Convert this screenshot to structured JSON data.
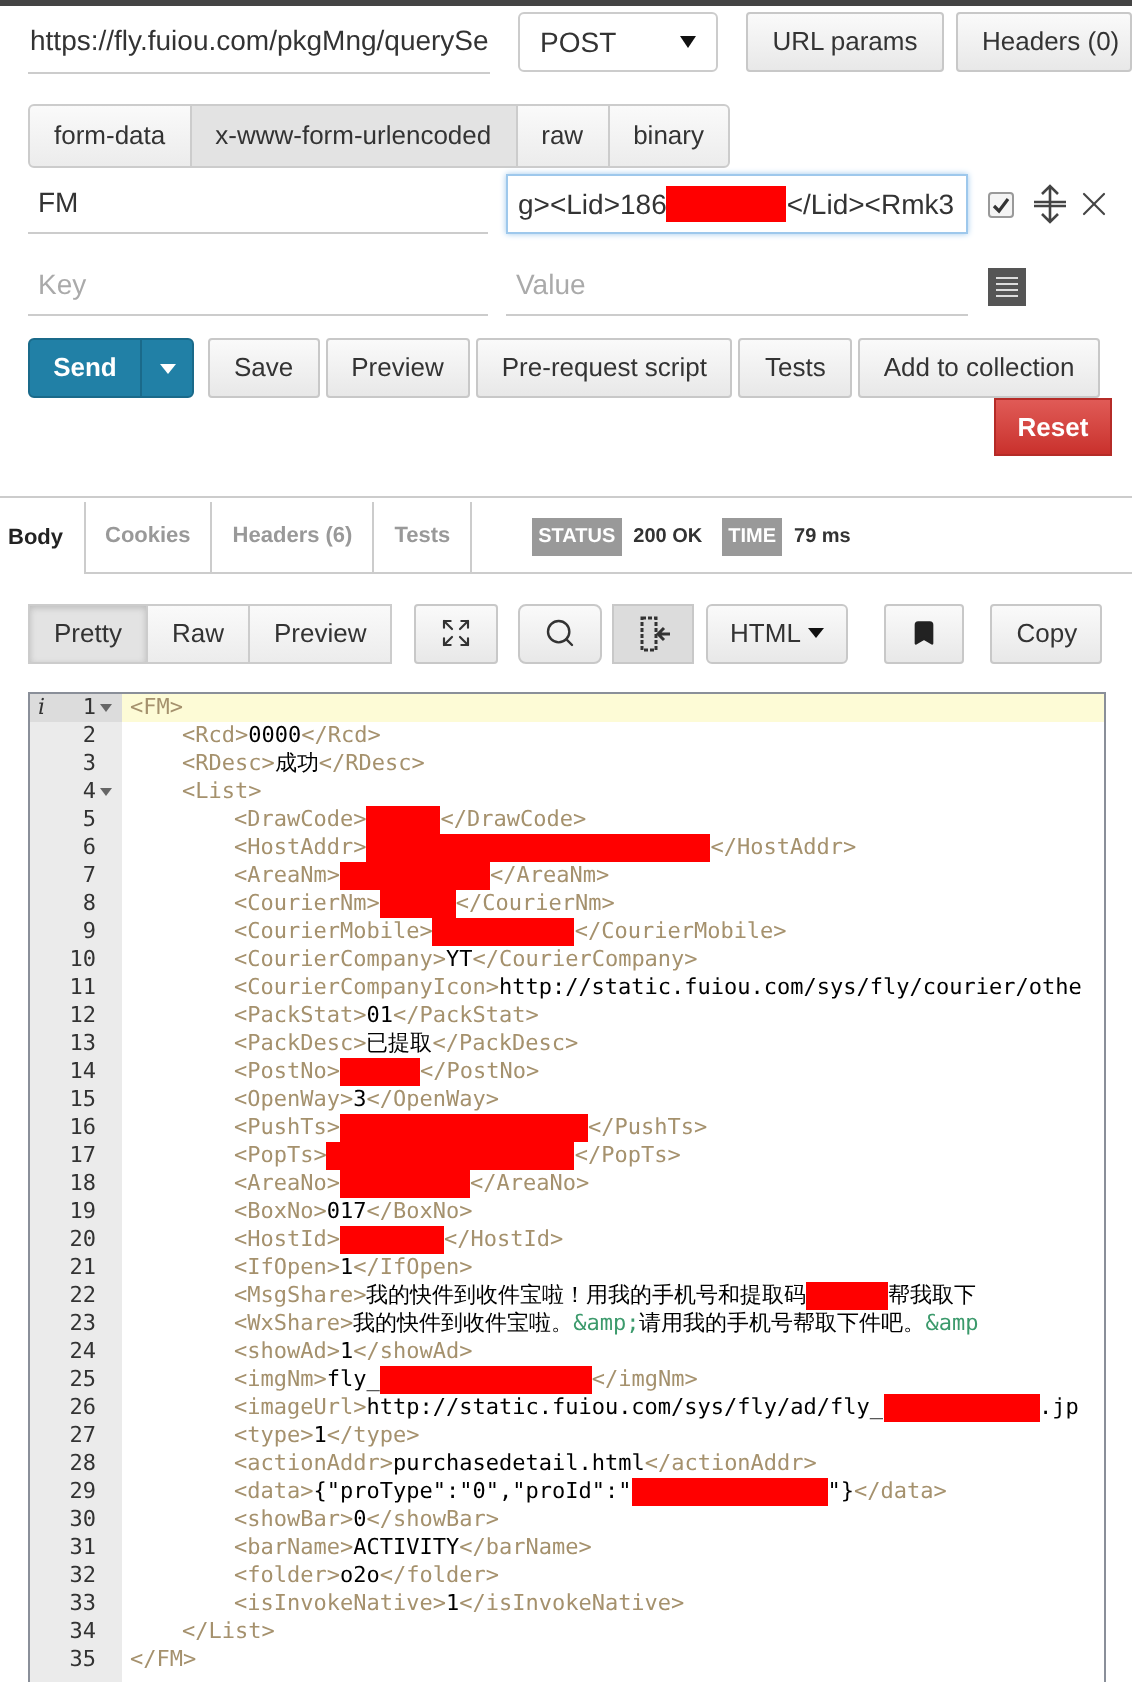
{
  "request": {
    "url": "https://fly.fuiou.com/pkgMng/querySe",
    "method": "POST",
    "buttons": [
      "URL params",
      "Headers (0)"
    ]
  },
  "body_tabs": [
    {
      "label": "form-data",
      "selected": false
    },
    {
      "label": "x-www-form-urlencoded",
      "selected": true
    },
    {
      "label": "raw",
      "selected": false
    },
    {
      "label": "binary",
      "selected": false
    }
  ],
  "params": [
    {
      "key": "FM",
      "value_parts": [
        {
          "kind": "text",
          "text": "g><Lid>186"
        },
        {
          "kind": "redacted"
        },
        {
          "kind": "text",
          "text": "</Lid><Rmk3"
        }
      ],
      "checked": true,
      "focused": true
    }
  ],
  "new_param": {
    "key_placeholder": "Key",
    "value_placeholder": "Value"
  },
  "actions": {
    "send": "Send",
    "buttons": [
      "Save",
      "Preview",
      "Pre-request script",
      "Tests",
      "Add to collection"
    ],
    "reset": "Reset"
  },
  "response_tabs": [
    {
      "label": "Body",
      "selected": true
    },
    {
      "label": "Cookies",
      "selected": false
    },
    {
      "label": "Headers (6)",
      "selected": false
    },
    {
      "label": "Tests",
      "selected": false
    }
  ],
  "status": {
    "label": "STATUS",
    "value": "200 OK"
  },
  "time": {
    "label": "TIME",
    "value": "79 ms"
  },
  "view_modes": [
    {
      "label": "Pretty",
      "selected": true
    },
    {
      "label": "Raw",
      "selected": false
    },
    {
      "label": "Preview",
      "selected": false
    }
  ],
  "wrap_on": true,
  "format": "HTML",
  "copy": "Copy",
  "editor": {
    "lines": [
      {
        "number": "1",
        "selected": true,
        "annotation": "i",
        "expanded": true,
        "parts": [
          {
            "kind": "tag",
            "text": "<FM>"
          }
        ],
        "children": [
          {
            "number": "2",
            "selected": false,
            "parts": [
              {
                "kind": "tag",
                "text": "<Rcd>"
              },
              {
                "kind": "text",
                "text": "0000"
              },
              {
                "kind": "tag",
                "text": "</Rcd>"
              }
            ]
          },
          {
            "number": "3",
            "selected": false,
            "parts": [
              {
                "kind": "tag",
                "text": "<RDesc>"
              },
              {
                "kind": "text",
                "text": "成功"
              },
              {
                "kind": "tag",
                "text": "</RDesc>"
              }
            ]
          },
          {
            "number": "4",
            "selected": false,
            "expanded": true,
            "parts": [
              {
                "kind": "tag",
                "text": "<List>"
              }
            ],
            "children": [
              {
                "number": "5",
                "selected": false,
                "parts": [
                  {
                    "kind": "tag",
                    "text": "<DrawCode>"
                  },
                  {
                    "kind": "redacted"
                  },
                  {
                    "kind": "tag",
                    "text": "</DrawCode>"
                  }
                ]
              },
              {
                "number": "6",
                "selected": false,
                "parts": [
                  {
                    "kind": "tag",
                    "text": "<HostAddr>"
                  },
                  {
                    "kind": "redacted"
                  },
                  {
                    "kind": "tag",
                    "text": "</HostAddr>"
                  }
                ]
              },
              {
                "number": "7",
                "selected": false,
                "parts": [
                  {
                    "kind": "tag",
                    "text": "<AreaNm>"
                  },
                  {
                    "kind": "redacted"
                  },
                  {
                    "kind": "tag",
                    "text": "</AreaNm>"
                  }
                ]
              },
              {
                "number": "8",
                "selected": false,
                "parts": [
                  {
                    "kind": "tag",
                    "text": "<CourierNm>"
                  },
                  {
                    "kind": "redacted"
                  },
                  {
                    "kind": "tag",
                    "text": "</CourierNm>"
                  }
                ]
              },
              {
                "number": "9",
                "selected": false,
                "parts": [
                  {
                    "kind": "tag",
                    "text": "<CourierMobile>"
                  },
                  {
                    "kind": "redacted"
                  },
                  {
                    "kind": "tag",
                    "text": "</CourierMobile>"
                  }
                ]
              },
              {
                "number": "10",
                "selected": false,
                "parts": [
                  {
                    "kind": "tag",
                    "text": "<CourierCompany>"
                  },
                  {
                    "kind": "text",
                    "text": "YT"
                  },
                  {
                    "kind": "tag",
                    "text": "</CourierCompany>"
                  }
                ]
              },
              {
                "number": "11",
                "selected": false,
                "parts": [
                  {
                    "kind": "tag",
                    "text": "<CourierCompanyIcon>"
                  },
                  {
                    "kind": "text",
                    "text": "http://static.fuiou.com/sys/fly/courier/othe"
                  }
                ]
              },
              {
                "number": "12",
                "selected": false,
                "parts": [
                  {
                    "kind": "tag",
                    "text": "<PackStat>"
                  },
                  {
                    "kind": "text",
                    "text": "01"
                  },
                  {
                    "kind": "tag",
                    "text": "</PackStat>"
                  }
                ]
              },
              {
                "number": "13",
                "selected": false,
                "parts": [
                  {
                    "kind": "tag",
                    "text": "<PackDesc>"
                  },
                  {
                    "kind": "text",
                    "text": "已提取"
                  },
                  {
                    "kind": "tag",
                    "text": "</PackDesc>"
                  }
                ]
              },
              {
                "number": "14",
                "selected": false,
                "parts": [
                  {
                    "kind": "tag",
                    "text": "<PostNo>"
                  },
                  {
                    "kind": "redacted"
                  },
                  {
                    "kind": "tag",
                    "text": "</PostNo>"
                  }
                ]
              },
              {
                "number": "15",
                "selected": false,
                "parts": [
                  {
                    "kind": "tag",
                    "text": "<OpenWay>"
                  },
                  {
                    "kind": "text",
                    "text": "3"
                  },
                  {
                    "kind": "tag",
                    "text": "</OpenWay>"
                  }
                ]
              },
              {
                "number": "16",
                "selected": false,
                "parts": [
                  {
                    "kind": "tag",
                    "text": "<PushTs>"
                  },
                  {
                    "kind": "redacted"
                  },
                  {
                    "kind": "tag",
                    "text": "</PushTs>"
                  }
                ]
              },
              {
                "number": "17",
                "selected": false,
                "parts": [
                  {
                    "kind": "tag",
                    "text": "<PopTs>"
                  },
                  {
                    "kind": "redacted"
                  },
                  {
                    "kind": "tag",
                    "text": "</PopTs>"
                  }
                ]
              },
              {
                "number": "18",
                "selected": false,
                "parts": [
                  {
                    "kind": "tag",
                    "text": "<AreaNo>"
                  },
                  {
                    "kind": "redacted"
                  },
                  {
                    "kind": "tag",
                    "text": "</AreaNo>"
                  }
                ]
              },
              {
                "number": "19",
                "selected": false,
                "parts": [
                  {
                    "kind": "tag",
                    "text": "<BoxNo>"
                  },
                  {
                    "kind": "text",
                    "text": "017"
                  },
                  {
                    "kind": "tag",
                    "text": "</BoxNo>"
                  }
                ]
              },
              {
                "number": "20",
                "selected": false,
                "parts": [
                  {
                    "kind": "tag",
                    "text": "<HostId>"
                  },
                  {
                    "kind": "redacted"
                  },
                  {
                    "kind": "tag",
                    "text": "</HostId>"
                  }
                ]
              },
              {
                "number": "21",
                "selected": false,
                "parts": [
                  {
                    "kind": "tag",
                    "text": "<IfOpen>"
                  },
                  {
                    "kind": "text",
                    "text": "1"
                  },
                  {
                    "kind": "tag",
                    "text": "</IfOpen>"
                  }
                ]
              },
              {
                "number": "22",
                "selected": false,
                "parts": [
                  {
                    "kind": "tag",
                    "text": "<MsgShare>"
                  },
                  {
                    "kind": "text",
                    "text": "我的快件到收件宝啦！用我的手机号和提取码"
                  },
                  {
                    "kind": "redacted"
                  },
                  {
                    "kind": "text",
                    "text": "帮我取下"
                  }
                ]
              },
              {
                "number": "23",
                "selected": false,
                "parts": [
                  {
                    "kind": "tag",
                    "text": "<WxShare>"
                  },
                  {
                    "kind": "text",
                    "text": "我的快件到收件宝啦。"
                  },
                  {
                    "kind": "entity",
                    "text": "&amp;"
                  },
                  {
                    "kind": "text",
                    "text": "请用我的手机号帮取下件吧。"
                  },
                  {
                    "kind": "entity",
                    "text": "&amp"
                  }
                ]
              },
              {
                "number": "24",
                "selected": false,
                "parts": [
                  {
                    "kind": "tag",
                    "text": "<showAd>"
                  },
                  {
                    "kind": "text",
                    "text": "1"
                  },
                  {
                    "kind": "tag",
                    "text": "</showAd>"
                  }
                ]
              },
              {
                "number": "25",
                "selected": false,
                "parts": [
                  {
                    "kind": "tag",
                    "text": "<imgNm>"
                  },
                  {
                    "kind": "text",
                    "text": "fly_"
                  },
                  {
                    "kind": "redacted"
                  },
                  {
                    "kind": "tag",
                    "text": "</imgNm>"
                  }
                ]
              },
              {
                "number": "26",
                "selected": false,
                "parts": [
                  {
                    "kind": "tag",
                    "text": "<imageUrl>"
                  },
                  {
                    "kind": "text",
                    "text": "http://static.fuiou.com/sys/fly/ad/fly_"
                  },
                  {
                    "kind": "redacted"
                  },
                  {
                    "kind": "text",
                    "text": ".jp"
                  }
                ]
              },
              {
                "number": "27",
                "selected": false,
                "parts": [
                  {
                    "kind": "tag",
                    "text": "<type>"
                  },
                  {
                    "kind": "text",
                    "text": "1"
                  },
                  {
                    "kind": "tag",
                    "text": "</type>"
                  }
                ]
              },
              {
                "number": "28",
                "selected": false,
                "parts": [
                  {
                    "kind": "tag",
                    "text": "<actionAddr>"
                  },
                  {
                    "kind": "text",
                    "text": "purchasedetail.html"
                  },
                  {
                    "kind": "tag",
                    "text": "</actionAddr>"
                  }
                ]
              },
              {
                "number": "29",
                "selected": false,
                "parts": [
                  {
                    "kind": "tag",
                    "text": "<data>"
                  },
                  {
                    "kind": "text",
                    "text": "{\"proType\":\"0\",\"proId\":\""
                  },
                  {
                    "kind": "redacted"
                  },
                  {
                    "kind": "text",
                    "text": "\"}"
                  },
                  {
                    "kind": "tag",
                    "text": "</data>"
                  }
                ]
              },
              {
                "number": "30",
                "selected": false,
                "parts": [
                  {
                    "kind": "tag",
                    "text": "<showBar>"
                  },
                  {
                    "kind": "text",
                    "text": "0"
                  },
                  {
                    "kind": "tag",
                    "text": "</showBar>"
                  }
                ]
              },
              {
                "number": "31",
                "selected": false,
                "parts": [
                  {
                    "kind": "tag",
                    "text": "<barName>"
                  },
                  {
                    "kind": "text",
                    "text": "ACTIVITY"
                  },
                  {
                    "kind": "tag",
                    "text": "</barName>"
                  }
                ]
              },
              {
                "number": "32",
                "selected": false,
                "parts": [
                  {
                    "kind": "tag",
                    "text": "<folder>"
                  },
                  {
                    "kind": "text",
                    "text": "o2o"
                  },
                  {
                    "kind": "tag",
                    "text": "</folder>"
                  }
                ]
              },
              {
                "number": "33",
                "selected": false,
                "parts": [
                  {
                    "kind": "tag",
                    "text": "<isInvokeNative>"
                  },
                  {
                    "kind": "text",
                    "text": "1"
                  },
                  {
                    "kind": "tag",
                    "text": "</isInvokeNative>"
                  }
                ]
              }
            ]
          },
          {
            "number": "34",
            "selected": false,
            "parts": [
              {
                "kind": "tag",
                "text": "</List>"
              }
            ]
          }
        ]
      },
      {
        "number": "35",
        "selected": false,
        "parts": [
          {
            "kind": "tag",
            "text": "</FM>"
          }
        ]
      }
    ]
  }
}
